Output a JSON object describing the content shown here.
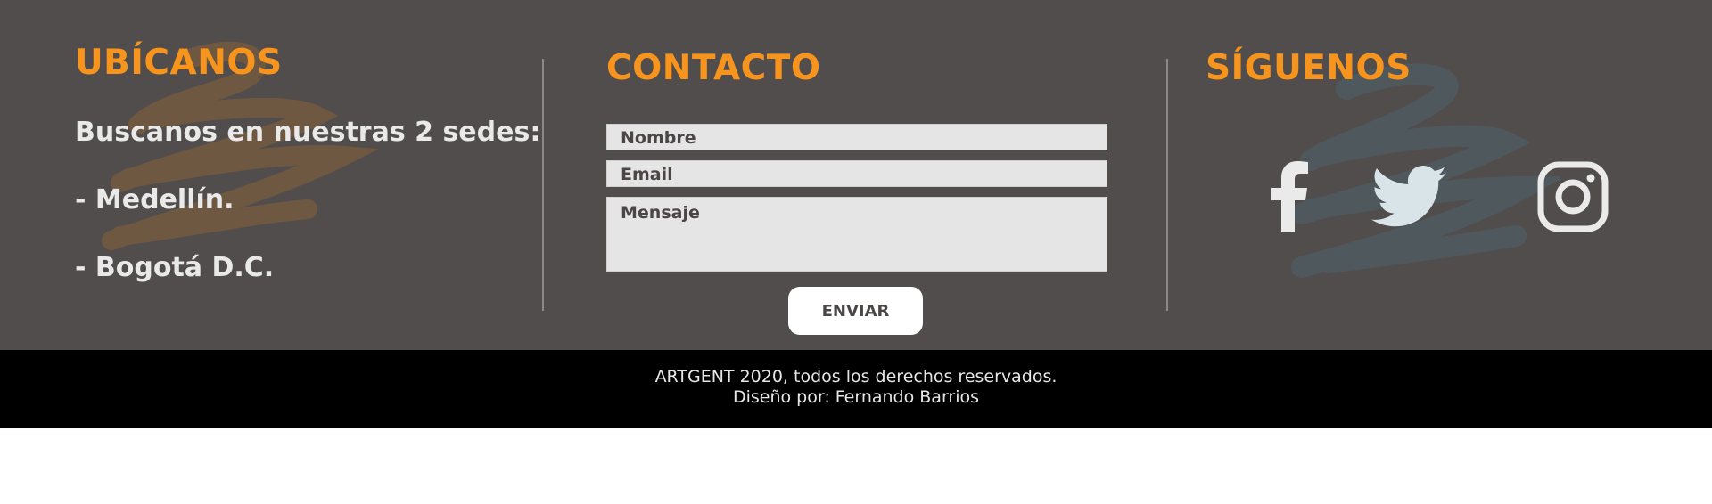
{
  "locations": {
    "heading": "UBÍCANOS",
    "intro": "Buscanos en nuestras 2 sedes:",
    "items": [
      "- Medellín.",
      "- Bogotá D.C."
    ]
  },
  "contact": {
    "heading": "CONTACTO",
    "name_placeholder": "Nombre",
    "email_placeholder": "Email",
    "message_placeholder": "Mensaje",
    "send_label": "ENVIAR"
  },
  "social": {
    "heading": "SÍGUENOS",
    "icons": [
      "facebook-icon",
      "twitter-icon",
      "instagram-icon"
    ]
  },
  "footer": {
    "copyright": "ARTGENT 2020, todos los derechos reservados.",
    "credit": "Diseño por: Fernando Barrios"
  },
  "colors": {
    "background": "#514d4c",
    "accent": "#f7941d",
    "bottom_bar": "#000000",
    "text_light": "#e9e9e9"
  }
}
